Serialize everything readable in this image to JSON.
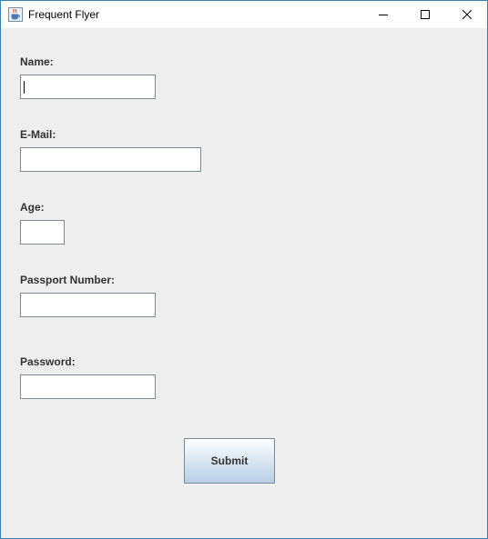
{
  "window": {
    "title": "Frequent Flyer"
  },
  "form": {
    "name": {
      "label": "Name:",
      "value": ""
    },
    "email": {
      "label": "E-Mail:",
      "value": ""
    },
    "age": {
      "label": "Age:",
      "value": ""
    },
    "passport": {
      "label": "Passport Number:",
      "value": ""
    },
    "password": {
      "label": "Password:",
      "value": ""
    },
    "submit_label": "Submit"
  },
  "icons": {
    "app": "java-coffee-cup-icon",
    "minimize": "minimize-icon",
    "maximize": "maximize-icon",
    "close": "close-icon"
  }
}
